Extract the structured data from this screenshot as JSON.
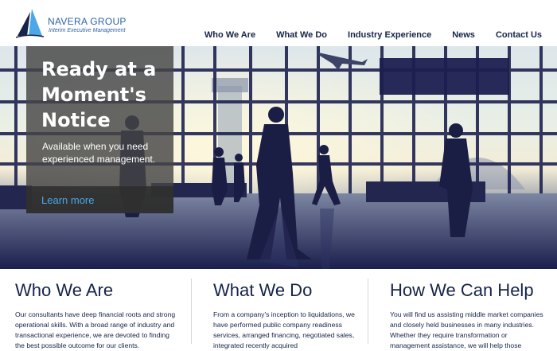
{
  "brand": {
    "name": "NAVERA GROUP",
    "tagline": "Interim Executive Management",
    "colors": {
      "primary": "#2e63a6",
      "dark": "#16244a",
      "link": "#4aa7e8"
    }
  },
  "nav": {
    "items": [
      {
        "label": "Who We Are"
      },
      {
        "label": "What We Do"
      },
      {
        "label": "Industry Experience"
      },
      {
        "label": "News"
      },
      {
        "label": "Contact Us"
      }
    ]
  },
  "hero": {
    "title_line1": "Ready at a",
    "title_line2": "Moment's",
    "title_line3": "Notice",
    "subtitle": "Available when you need experienced management.",
    "cta": "Learn more"
  },
  "columns": [
    {
      "heading": "Who We Are",
      "text": "Our consultants have deep financial roots and strong operational skills. With a broad range of industry and transactional experience, we are devoted to finding the best possible outcome for our clients."
    },
    {
      "heading": "What We Do",
      "text": "From a company's inception to liquidations, we have performed public company readiness services, arranged financing, negotiated sales, integrated recently acquired"
    },
    {
      "heading": "How We Can Help",
      "text": "You will find us assisting middle market companies and closely held businesses in many industries. Whether they require transformation or management assistance, we will help those"
    }
  ]
}
